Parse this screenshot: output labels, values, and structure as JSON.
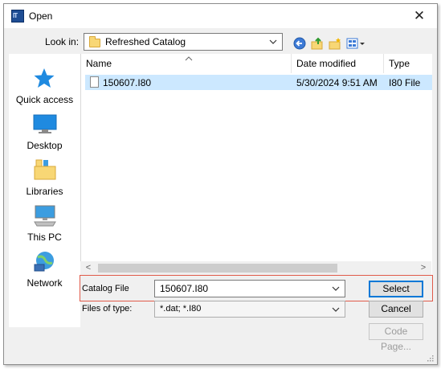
{
  "window": {
    "title": "Open",
    "close_glyph": "✕"
  },
  "lookin": {
    "label": "Look in:",
    "value": "Refreshed Catalog"
  },
  "places": [
    {
      "label": "Quick access",
      "icon": "star-icon"
    },
    {
      "label": "Desktop",
      "icon": "desktop-icon"
    },
    {
      "label": "Libraries",
      "icon": "libraries-icon"
    },
    {
      "label": "This PC",
      "icon": "computer-icon"
    },
    {
      "label": "Network",
      "icon": "network-icon"
    }
  ],
  "columns": {
    "name": "Name",
    "date": "Date modified",
    "type": "Type"
  },
  "files": [
    {
      "name": "150607.I80",
      "date": "5/30/2024 9:51 AM",
      "type": "I80 File"
    }
  ],
  "catalog": {
    "label": "Catalog File",
    "value": "150607.I80"
  },
  "filetype": {
    "label": "Files of type:",
    "value": "*.dat; *.I80"
  },
  "buttons": {
    "select": "Select",
    "cancel": "Cancel",
    "code_page": "Code Page..."
  },
  "colors": {
    "selection": "#cce8ff",
    "accent": "#0078d7",
    "highlight_box": "#e05a4a"
  }
}
